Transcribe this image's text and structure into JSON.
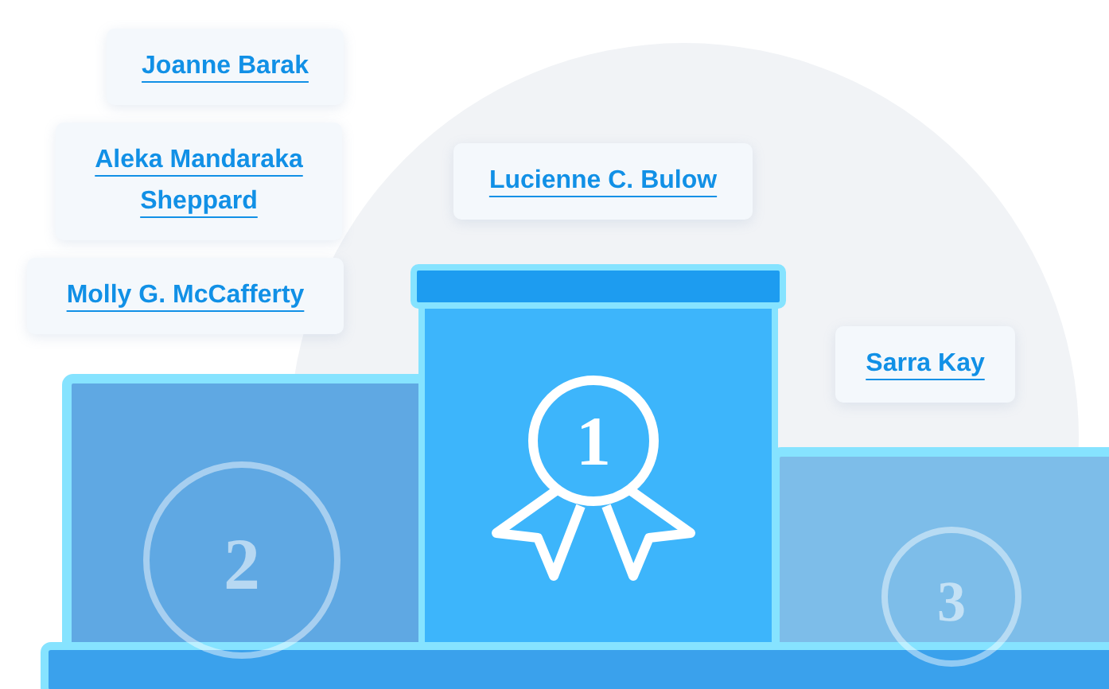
{
  "names": [
    {
      "text": "Joanne Barak"
    },
    {
      "text": "Aleka Mandaraka Sheppard"
    },
    {
      "text": "Lucienne C. Bulow"
    },
    {
      "text": "Molly G. McCafferty"
    },
    {
      "text": "Sarra Kay"
    }
  ],
  "podium": [
    {
      "place": "2"
    },
    {
      "place": "1"
    },
    {
      "place": "3"
    }
  ]
}
